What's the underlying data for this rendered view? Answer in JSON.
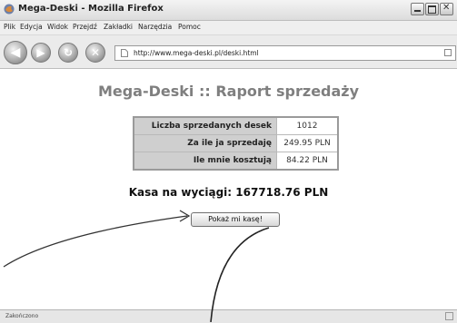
{
  "window": {
    "title": "Mega-Deski - Mozilla Firefox"
  },
  "menu": {
    "items": [
      "Plik",
      "Edycja",
      "Widok",
      "Przejdź",
      "Zakładki",
      "Narzędzia",
      "Pomoc"
    ]
  },
  "navigation": {
    "url": "http://www.mega-deski.pl/deski.html"
  },
  "page": {
    "heading": "Mega-Deski :: Raport sprzedaży",
    "table": [
      {
        "label": "Liczba sprzedanych desek",
        "value": "1012"
      },
      {
        "label": "Za ile ja sprzedaję",
        "value": "249.95 PLN"
      },
      {
        "label": "Ile mnie kosztują",
        "value": "84.22 PLN"
      }
    ],
    "summary": "Kasa na wyciągi: 167718.76 PLN",
    "button_label": "Pokaż mi kasę!"
  },
  "status": {
    "text": "Zakończono"
  },
  "colors": {
    "heading": "#7f7f7f",
    "label_cell_bg": "#cfcfcf",
    "annotation_line": "#333333"
  }
}
